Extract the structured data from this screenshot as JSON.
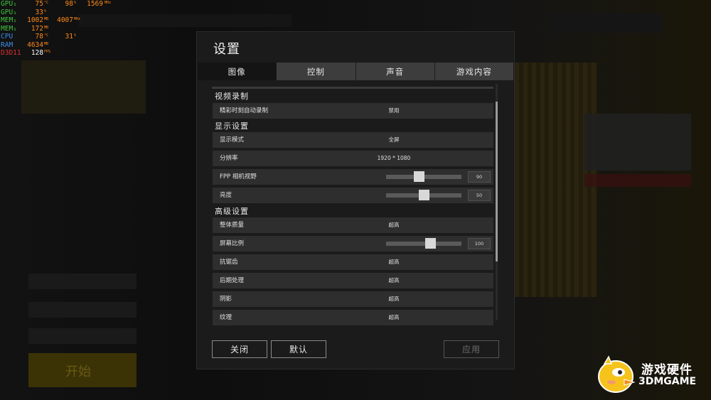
{
  "osd": {
    "rows": [
      {
        "label": "GPU₁",
        "class": "c-gpu",
        "v1": "75",
        "u1": "°C",
        "v2": "98",
        "u2": "%",
        "v3": "1569",
        "u3": "MHz"
      },
      {
        "label": "GPU₁",
        "class": "c-gpu",
        "v1": "33",
        "u1": "%",
        "v2": "",
        "u2": "",
        "v3": "",
        "u3": ""
      },
      {
        "label": "MEM₁",
        "class": "c-mem",
        "v1": "1002",
        "u1": "MB",
        "v2": "4007",
        "u2": "MHz",
        "v3": "",
        "u3": ""
      },
      {
        "label": "MEM₁",
        "class": "c-mem",
        "v1": "172",
        "u1": "MB",
        "v2": "",
        "u2": "",
        "v3": "",
        "u3": ""
      },
      {
        "label": "CPU",
        "class": "c-cpu",
        "v1": "78",
        "u1": "°C",
        "v2": "31",
        "u2": "%",
        "v3": "",
        "u3": ""
      },
      {
        "label": "RAM",
        "class": "c-ram",
        "v1": "4634",
        "u1": "MB",
        "v2": "",
        "u2": "",
        "v3": "",
        "u3": ""
      },
      {
        "label": "D3D11",
        "class": "c-d3d",
        "v1": "128",
        "u1": "FPS",
        "v2": "",
        "u2": "",
        "v3": "",
        "u3": ""
      }
    ]
  },
  "background": {
    "start_label": "开始"
  },
  "dialog": {
    "title": "设置",
    "tabs": [
      {
        "label": "图像",
        "active": true
      },
      {
        "label": "控制",
        "active": false
      },
      {
        "label": "声音",
        "active": false
      },
      {
        "label": "游戏内容",
        "active": false
      }
    ],
    "sections": {
      "video_recording": "视频录制",
      "display": "显示设置",
      "advanced": "高级设置"
    },
    "rows": {
      "highlight_record": {
        "label": "精彩时刻自动录制",
        "value": "禁用"
      },
      "display_mode": {
        "label": "显示模式",
        "value": "全屏"
      },
      "resolution": {
        "label": "分辨率",
        "value": "1920 * 1080"
      },
      "fpp_fov": {
        "label": "FPP 相机视野",
        "value": "90",
        "level": 0.43
      },
      "brightness": {
        "label": "亮度",
        "value": "50",
        "level": 0.5
      },
      "overall_quality": {
        "label": "整体质量",
        "value": "超高"
      },
      "screen_scale": {
        "label": "屏幕比例",
        "value": "100",
        "level": 0.6
      },
      "anti_aliasing": {
        "label": "抗锯齿",
        "value": "超高"
      },
      "post_processing": {
        "label": "后期处理",
        "value": "超高"
      },
      "shadows": {
        "label": "阴影",
        "value": "超高"
      },
      "textures": {
        "label": "纹理",
        "value": "超高"
      }
    },
    "buttons": {
      "close": "关闭",
      "default": "默认",
      "apply": "应用"
    }
  },
  "watermark": {
    "line1": "游戏硬件",
    "line2": "3DMGAME"
  }
}
